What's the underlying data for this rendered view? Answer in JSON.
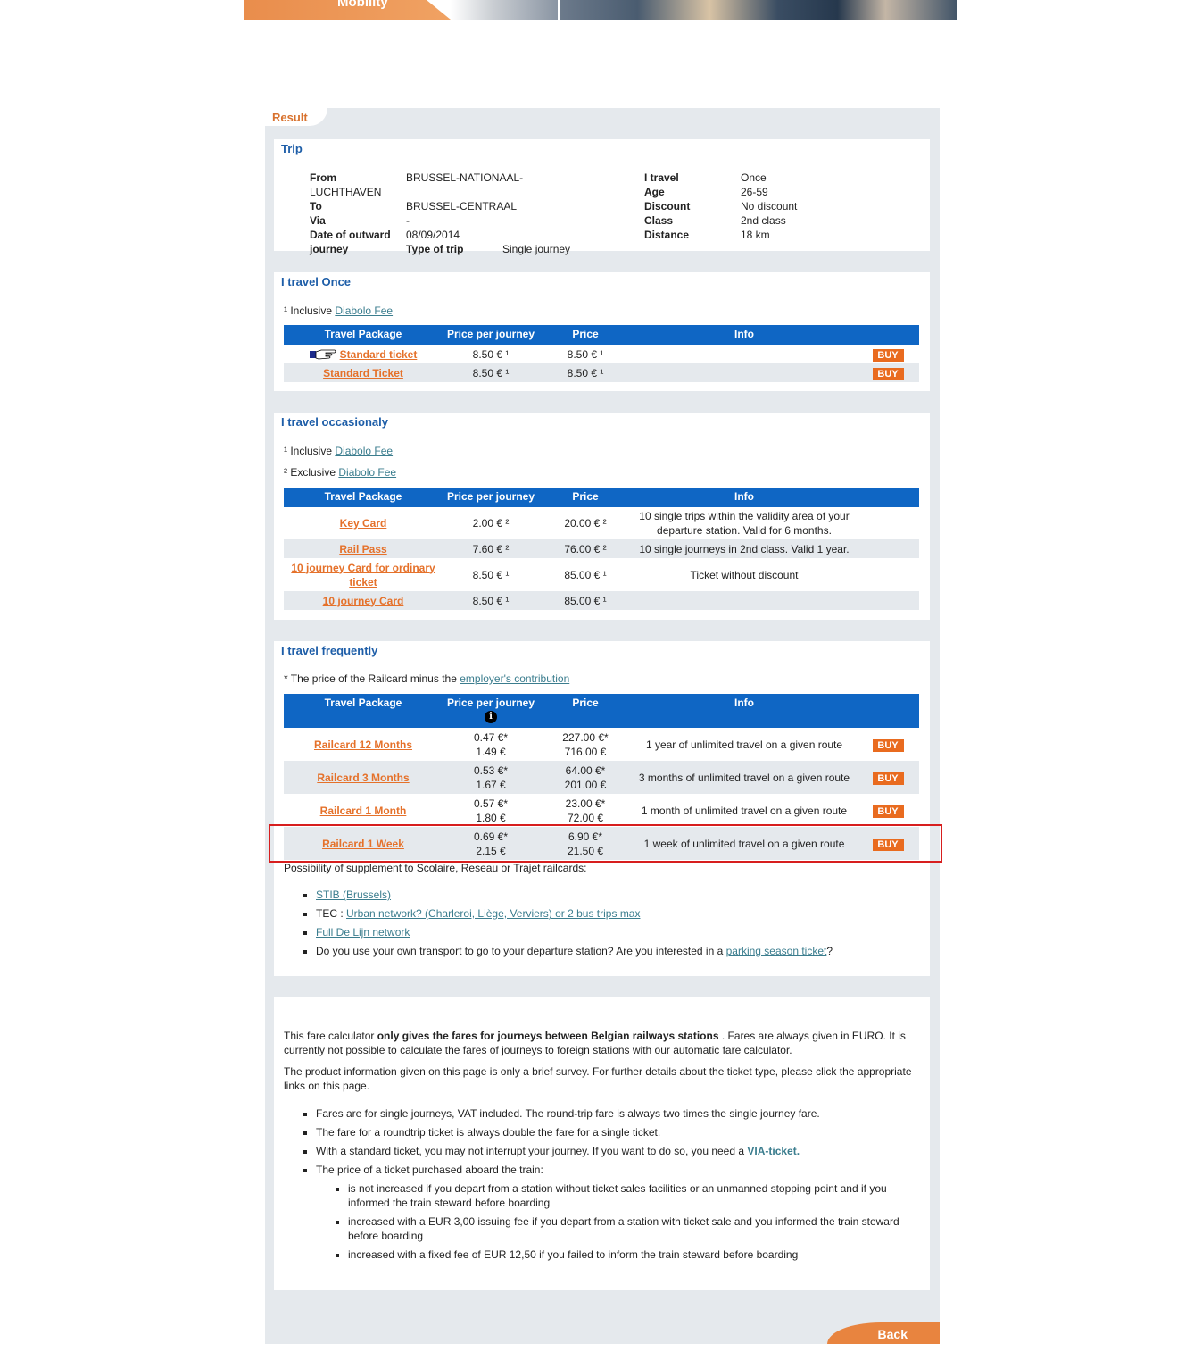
{
  "banner": {
    "brand_text": "Mobility"
  },
  "result_tab": "Result",
  "trip": {
    "title": "Trip",
    "rows_left": [
      {
        "label": "From",
        "value": "BRUSSEL-NATIONAAL-"
      },
      {
        "label": "LUCHTHAVEN",
        "value": ""
      },
      {
        "label": "To",
        "value": "BRUSSEL-CENTRAAL"
      },
      {
        "label": "Via",
        "value": "-"
      },
      {
        "label": "Date of outward",
        "value": "08/09/2014"
      },
      {
        "label": "journey",
        "value": "Type of trip",
        "extra": "Single journey"
      }
    ],
    "rows_right": [
      {
        "label": "I travel",
        "value": "Once"
      },
      {
        "label": "Age",
        "value": "26-59"
      },
      {
        "label": "Discount",
        "value": "No discount"
      },
      {
        "label": "Class",
        "value": "2nd class"
      },
      {
        "label": "Distance",
        "value": "18 km"
      }
    ]
  },
  "headers": {
    "package": "Travel Package",
    "ppj": "Price per journey",
    "price": "Price",
    "info": "Info"
  },
  "once": {
    "title": "I travel Once",
    "note_prefix": "¹ Inclusive ",
    "note_link": "Diabolo Fee",
    "rows": [
      {
        "name": "Standard ticket",
        "ppj": "8.50 € ¹",
        "price": "8.50 € ¹",
        "info": "",
        "buy": "BUY"
      },
      {
        "name": "Standard Ticket",
        "ppj": "8.50 € ¹",
        "price": "8.50 € ¹",
        "info": "",
        "buy": "BUY"
      }
    ]
  },
  "occasional": {
    "title": "I travel occasionaly",
    "note1_prefix": "¹ Inclusive ",
    "note1_link": "Diabolo Fee",
    "note2_prefix": "² Exclusive ",
    "note2_link": "Diabolo Fee",
    "rows": [
      {
        "name": "Key Card",
        "ppj": "2.00 € ²",
        "price": "20.00 € ²",
        "info": "10 single trips within the validity area of your departure station. Valid for 6 months."
      },
      {
        "name": "Rail Pass",
        "ppj": "7.60 € ²",
        "price": "76.00 € ²",
        "info": "10 single journeys in 2nd class. Valid 1 year."
      },
      {
        "name": "10 journey Card for ordinary ticket",
        "ppj": "8.50 € ¹",
        "price": "85.00 € ¹",
        "info": "Ticket without discount"
      },
      {
        "name": "10 journey Card",
        "ppj": "8.50 € ¹",
        "price": "85.00 € ¹",
        "info": ""
      }
    ]
  },
  "frequent": {
    "title": "I travel frequently",
    "note_prefix": "* The price of the Railcard minus the ",
    "note_link": "employer's contribution",
    "rows": [
      {
        "name": "Railcard 12 Months",
        "ppj1": "0.47 €*",
        "ppj2": "1.49 €",
        "price1": "227.00 €*",
        "price2": "716.00 €",
        "info": "1 year of unlimited travel on a given route",
        "buy": "BUY"
      },
      {
        "name": "Railcard 3 Months",
        "ppj1": "0.53 €*",
        "ppj2": "1.67 €",
        "price1": "64.00 €*",
        "price2": "201.00 €",
        "info": "3 months of unlimited travel on a given route",
        "buy": "BUY"
      },
      {
        "name": "Railcard 1 Month",
        "ppj1": "0.57 €*",
        "ppj2": "1.80 €",
        "price1": "23.00 €*",
        "price2": "72.00 €",
        "info": "1 month of unlimited travel on a given route",
        "buy": "BUY"
      },
      {
        "name": "Railcard 1 Week",
        "ppj1": "0.69 €*",
        "ppj2": "2.15 €",
        "price1": "6.90 €*",
        "price2": "21.50 €",
        "info": "1 week of unlimited travel on a given route",
        "buy": "BUY"
      }
    ],
    "supplement_text": "Possibility of supplement to Scolaire, Reseau or Trajet railcards:",
    "supplements": {
      "stib": "STIB (Brussels)",
      "tec_prefix": "TEC : ",
      "tec_link": "Urban network? (Charleroi, Liège, Verviers) or 2 bus trips max",
      "delijn": "Full De Lijn network",
      "parking_prefix": "Do you use your own transport to go to your departure station? Are you interested in a ",
      "parking_link": "parking season ticket",
      "parking_suffix": "?"
    }
  },
  "info_box": {
    "p1_a": "This fare calculator ",
    "p1_bold": "only gives the fares for journeys between Belgian railways stations",
    "p1_b": " . Fares are always given in EURO. It is currently not possible to calculate the fares of journeys to foreign stations with our automatic fare calculator.",
    "p2": "The product information given on this page is only a brief survey. For further details about the ticket type, please click the appropriate links on this page.",
    "bullet1": "Fares are for single journeys, VAT included. The round-trip fare is always two times the single journey fare.",
    "bullet2": "The fare for a roundtrip ticket is always double the fare for a single ticket.",
    "bullet3_prefix": "With a standard ticket, you may not interrupt your journey. If you want to do so, you need a ",
    "bullet3_link": "VIA-ticket.",
    "bullet4": "The price of a ticket purchased aboard the train:",
    "sub1": "is not increased if you depart from a station without ticket sales facilities or an unmanned stopping point and if you informed the train steward before boarding",
    "sub2": "increased with a EUR 3,00 issuing fee if you depart from a station with ticket sale and you informed the train steward before boarding",
    "sub3": "increased with a fixed fee of EUR 12,50 if you failed to inform the train steward before boarding"
  },
  "back_label": "Back",
  "colors": {
    "accent": "#e96b1f",
    "header_blue": "#0f66c4",
    "title_blue": "#1e5ea8",
    "highlight": "#d71e1e"
  }
}
